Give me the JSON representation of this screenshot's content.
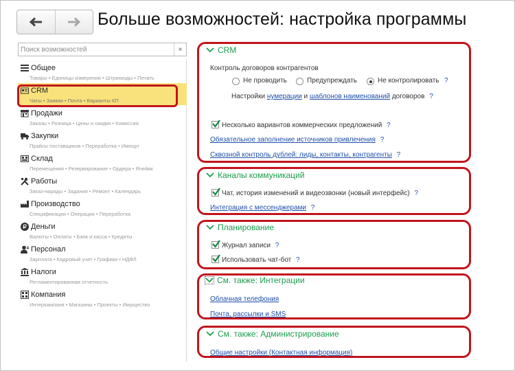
{
  "header": {
    "title": "Больше возможностей: настройка программы",
    "back_icon": "arrow-left-icon",
    "forward_icon": "arrow-right-icon"
  },
  "search": {
    "placeholder": "Поиск возможностей",
    "value": "",
    "clear_label": "×"
  },
  "sidebar": {
    "items": [
      {
        "label": "Общее",
        "sub": "Товары • Единицы измерения • Штрихкоды • Печать",
        "icon": "list-icon",
        "active": false
      },
      {
        "label": "CRM",
        "sub": "Чаты • Заявки • Почта • Варианты КП",
        "icon": "crm-card-icon",
        "active": true
      },
      {
        "label": "Продажи",
        "sub": "Заказы • Розница • Цены и скидки • Комиссия",
        "icon": "store-icon",
        "active": false
      },
      {
        "label": "Закупки",
        "sub": "Прайсы поставщиков • Переработка • Импорт",
        "icon": "truck-icon",
        "active": false
      },
      {
        "label": "Склад",
        "sub": "Перемещения • Резервирование • Ордера • Ячейки",
        "icon": "warehouse-icon",
        "active": false
      },
      {
        "label": "Работы",
        "sub": "Заказ-наряды • Задания • Ремонт • Календарь",
        "icon": "tools-icon",
        "active": false
      },
      {
        "label": "Производство",
        "sub": "Спецификации • Операции • Переработка",
        "icon": "factory-icon",
        "active": false
      },
      {
        "label": "Деньги",
        "sub": "Валюты • Оплаты • Банк и касса • Кредиты",
        "icon": "ruble-coin-icon",
        "active": false
      },
      {
        "label": "Персонал",
        "sub": "Зарплата • Кадровый учет • Графики • НДФЛ",
        "icon": "person-icon",
        "active": false
      },
      {
        "label": "Налоги",
        "sub": "Регламентированная отчетность",
        "icon": "bank-icon",
        "active": false
      },
      {
        "label": "Компания",
        "sub": "Интеркампани • Магазины • Проекты • Имущество",
        "icon": "company-icon",
        "active": false
      }
    ]
  },
  "sections": {
    "crm": {
      "title": "CRM",
      "contract_label": "Контроль договоров контрагентов",
      "radio_options": [
        "Не проводить",
        "Предупреждать",
        "Не контролировать"
      ],
      "radio_selected": "Не контролировать",
      "settings_prefix": "Настройки",
      "numbering_link": "нумерации",
      "and_text": "и",
      "templates_link": "шаблонов наименований",
      "contracts_suffix": "договоров",
      "multi_kp_label": "Несколько вариантов коммерческих предложений",
      "multi_kp_checked": true,
      "required_sources_link": "Обязательное заполнение источников привлечения",
      "duplicates_link": "Сквозной контроль дублей: лиды, контакты, контрагенты"
    },
    "channels": {
      "title": "Каналы коммуникаций",
      "chat_label": "Чат, история изменений и видеозвонки (новый интерфейс)",
      "chat_checked": true,
      "messengers_link": "Интеграция с мессенджерами"
    },
    "planning": {
      "title": "Планирование",
      "journal_label": "Журнал записи",
      "journal_checked": true,
      "chatbot_label": "Использовать чат-бот",
      "chatbot_checked": true
    },
    "integrations": {
      "title": "См. также: Интеграции",
      "telephony_link": "Облачная телефония",
      "mail_link": "Почта, рассылки и SMS"
    },
    "admin": {
      "title": "См. также: Администрирование",
      "general_link": "Общие настройки (Контактная информация)"
    }
  },
  "help_mark": "?",
  "colors": {
    "accent_green": "#1a9d4c",
    "link_blue": "#1f4fa8",
    "highlight_red": "#c1141c",
    "active_yellow": "#f9e27b"
  }
}
